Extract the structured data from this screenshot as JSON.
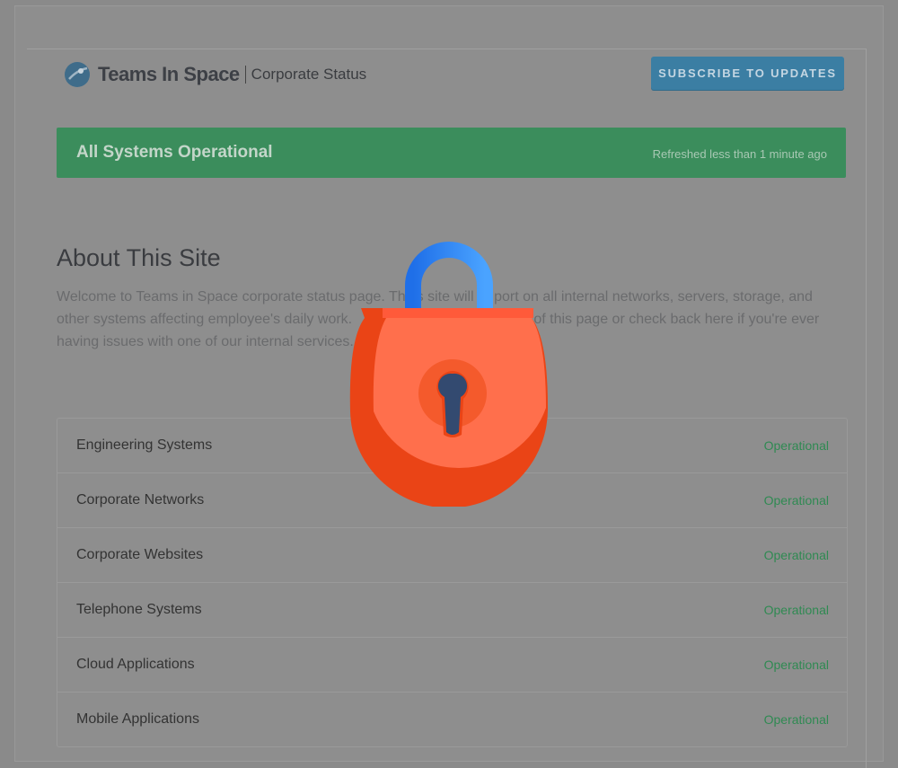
{
  "header": {
    "brand": "Teams In Space",
    "subtitle": "Corporate Status",
    "subscribe_label": "SUBSCRIBE TO UPDATES"
  },
  "banner": {
    "title": "All Systems Operational",
    "refreshed": "Refreshed less than 1 minute ago"
  },
  "about": {
    "title": "About This Site",
    "text_visible": "Welcome to Teams in Space corporate status page. Th",
    "text_line1_b": "s site will ",
    "text_line1_c": "port on all internal networks, servers, storage, and",
    "text_line2_a": "other systems affecting employee's daily work.",
    "text_line2_b": "op of this page or check back here if you're ever",
    "text_line3_a": "having issues with one of our internal services."
  },
  "components": [
    {
      "name": "Engineering Systems",
      "status": "Operational"
    },
    {
      "name": "Corporate Networks",
      "status": "Operational"
    },
    {
      "name": "Corporate Websites",
      "status": "Operational"
    },
    {
      "name": "Telephone Systems",
      "status": "Operational"
    },
    {
      "name": "Cloud Applications",
      "status": "Operational"
    },
    {
      "name": "Mobile Applications",
      "status": "Operational"
    }
  ],
  "colors": {
    "banner": "#3b8d5c",
    "subscribe": "#3b7ea3",
    "status_ok": "#2f8a52",
    "lock_body": "#ff6a45",
    "lock_shackle": "#2f7cf0"
  },
  "icons": {
    "logo": "rocket-planet-icon",
    "overlay": "padlock-icon"
  }
}
